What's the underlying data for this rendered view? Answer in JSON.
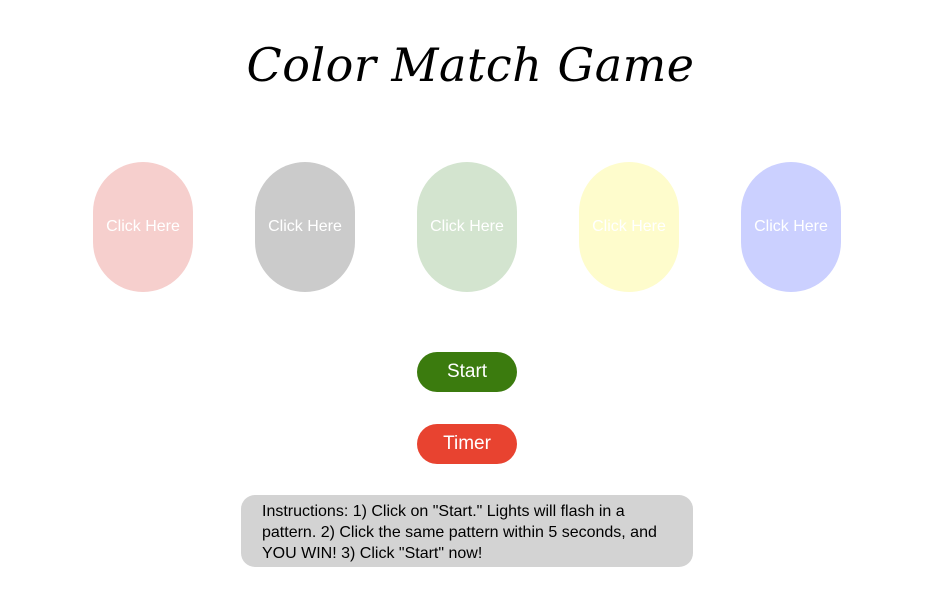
{
  "title": "Color Match Game",
  "lights": [
    {
      "label": "Click Here",
      "color": "#f6cfcd"
    },
    {
      "label": "Click Here",
      "color": "#cbcbcb"
    },
    {
      "label": "Click Here",
      "color": "#d3e4cf"
    },
    {
      "label": "Click Here",
      "color": "#fefccc"
    },
    {
      "label": "Click Here",
      "color": "#cbd0ff"
    }
  ],
  "controls": {
    "start_label": "Start",
    "start_color": "#3b7b0e",
    "timer_label": "Timer",
    "timer_color": "#e84330"
  },
  "instructions": "Instructions: 1) Click on \"Start.\" Lights will flash in a pattern. 2) Click the same pattern within 5 seconds, and YOU WIN! 3) Click \"Start\" now!"
}
